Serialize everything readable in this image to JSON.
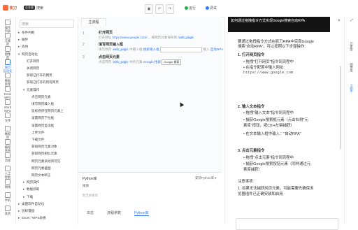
{
  "app": {
    "brand": "影刀",
    "badge": "企业版",
    "doc_name": "搜索"
  },
  "toolbar": {
    "run_label": "运行",
    "debug_label": "调试"
  },
  "left_nav": [
    {
      "label": "操作\n列表"
    },
    {
      "label": "元素\n库"
    },
    {
      "label": "图像\n库"
    },
    {
      "label": "网页\n自动化"
    },
    {
      "label": "数据\n处理"
    },
    {
      "label": "Excel\nWPS"
    },
    {
      "label": "Word\nWPS"
    },
    {
      "label": "文件"
    },
    {
      "label": "数据\n库"
    },
    {
      "label": "编程\n系统"
    },
    {
      "label": "流程"
    },
    {
      "label": "人工\n智能"
    },
    {
      "label": "网络"
    },
    {
      "label": "手机"
    },
    {
      "label": "其他"
    }
  ],
  "tree": {
    "search_placeholder": "搜索",
    "items": [
      {
        "label": "条件判断",
        "caret": "▸",
        "indent": 0
      },
      {
        "label": "循环",
        "caret": "▸",
        "indent": 0
      },
      {
        "label": "等待",
        "caret": "▸",
        "indent": 0
      },
      {
        "label": "网页自动化",
        "caret": "▾",
        "indent": 0
      },
      {
        "label": "打开网页",
        "caret": "",
        "indent": 1
      },
      {
        "label": "关闭网页",
        "caret": "",
        "indent": 1
      },
      {
        "label": "获取已打开的网页",
        "caret": "",
        "indent": 1
      },
      {
        "label": "获取已打开的所有网页",
        "caret": "",
        "indent": 1
      },
      {
        "label": "元素操作",
        "caret": "▾",
        "indent": 1
      },
      {
        "label": "点击网页元素",
        "caret": "",
        "indent": 2
      },
      {
        "label": "填写网页输入框",
        "caret": "",
        "indent": 2
      },
      {
        "label": "鼠标悬停在网页元素上",
        "caret": "",
        "indent": 2
      },
      {
        "label": "设置网页下拉框",
        "caret": "",
        "indent": 2
      },
      {
        "label": "设置网页复选框",
        "caret": "",
        "indent": 2
      },
      {
        "label": "上传文件",
        "caret": "",
        "indent": 2
      },
      {
        "label": "下载文件",
        "caret": "",
        "indent": 2
      },
      {
        "label": "获取网页元素对象",
        "caret": "",
        "indent": 2
      },
      {
        "label": "获取网页相似元素",
        "caret": "",
        "indent": 2
      },
      {
        "label": "网页元素滚动到可见",
        "caret": "",
        "indent": 2
      },
      {
        "label": "网页元素截图",
        "caret": "",
        "indent": 2
      },
      {
        "label": "网页文本断言",
        "caret": "",
        "indent": 2
      },
      {
        "label": "网页操作",
        "caret": "▸",
        "indent": 1
      },
      {
        "label": "数据抓取",
        "caret": "▸",
        "indent": 1
      },
      {
        "label": "下载",
        "caret": "▸",
        "indent": 1
      },
      {
        "label": "桌面软件自动化",
        "caret": "▸",
        "indent": 0
      },
      {
        "label": "鼠标键盘",
        "caret": "▸",
        "indent": 0
      },
      {
        "label": "Excel / WPS表格",
        "caret": "▸",
        "indent": 0
      }
    ]
  },
  "editor": {
    "tab": "主流程",
    "steps": [
      {
        "num": "1",
        "title": "打开网页",
        "desc_pre": "打开网址",
        "desc_url": "https://www.google.com/",
        "desc_post": "，将网页对象保存到",
        "tag": "web_page"
      },
      {
        "num": "2",
        "title": "填写网页输入框",
        "desc_pre": "填写网页",
        "tag": "web_page",
        "desc_mid": "中输入框",
        "desc_elem": "搜索输入框",
        "desc_post2": "输入",
        "desc_val": "自动RPA"
      },
      {
        "num": "3",
        "title": "点击网页元素",
        "desc_pre": "点击网页",
        "tag": "web_page",
        "desc_mid": "中的元素",
        "desc_elem": "Google 搜索",
        "btn": "Google 搜索"
      }
    ]
  },
  "bottom": {
    "title": "Python库",
    "select": "安装Python库",
    "search_label": "搜索",
    "empty": "暂无依赖库",
    "tabs": [
      "日志",
      "流程参数",
      "Python库"
    ],
    "active_tab": 2
  },
  "panel": {
    "header": "如何通过拖拽指令方式实现Google搜索自动RPA",
    "lines": [
      {
        "text": "要通过拖拽指令方式在影刀RPA中实现Google",
        "style": "normal"
      },
      {
        "text": "搜索\"自动RPA\"，可以按照以下步骤操作：",
        "style": "normal"
      },
      {
        "text": "1. 打开网页指令",
        "style": "bold"
      },
      {
        "text": "• 拖拽\"打开网页\"指令到流程中",
        "style": "normal"
      },
      {
        "text": "• 在指令配置中输入网址:",
        "style": "normal"
      },
      {
        "text": "  https://www.google.com",
        "style": "mono"
      },
      {
        "text": "2. 输入文本指令",
        "style": "bold"
      },
      {
        "text": "• 拖拽\"输入文本\"指令到流程中",
        "style": "normal"
      },
      {
        "text": "• 捕获Google搜索框元素（点击右侧\"元",
        "style": "normal"
      },
      {
        "text": "  素库\"按钮，按Ctrl+左键捕获）",
        "style": "normal"
      },
      {
        "text": "• 在文本输入框中输入：\"自动RPA\"",
        "style": "normal"
      },
      {
        "text": "3. 点击元素指令",
        "style": "bold"
      },
      {
        "text": "• 拖拽\"点击元素\"指令到流程中",
        "style": "normal"
      },
      {
        "text": "• 捕获Google搜索按钮元素（同样通过元",
        "style": "normal"
      },
      {
        "text": "  素库捕获）",
        "style": "normal"
      },
      {
        "text": "注意事项：",
        "style": "normal"
      },
      {
        "text": "1. 如果无法捕获网页元素，可能需要先确保浏",
        "style": "normal"
      },
      {
        "text": "   览器插件已正确安装和启用",
        "style": "normal"
      }
    ]
  },
  "right_nav": [
    {
      "label": "元素库"
    },
    {
      "label": "图像库"
    },
    {
      "label": "AI助手"
    }
  ]
}
